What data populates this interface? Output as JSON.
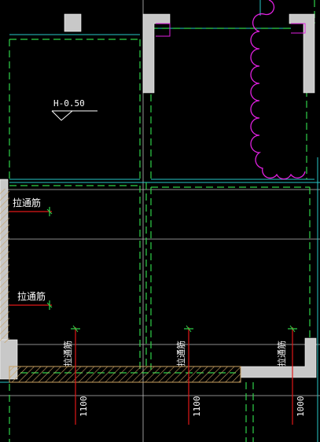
{
  "drawing": {
    "elevation_marker": "H-0.50",
    "rebar_label_horizontal": "拉通筋",
    "rebar_label_vertical": "拉通筋",
    "dimensions": [
      "1100",
      "1100",
      "1000"
    ]
  },
  "colors": {
    "background": "#000000",
    "wall_fill": "#c8c8c8",
    "dashed_green": "#2fd24a",
    "cyan": "#29c8c8",
    "magenta": "#e020e0",
    "red": "#e01818",
    "hatch": "#c8a060",
    "white": "#ffffff"
  }
}
